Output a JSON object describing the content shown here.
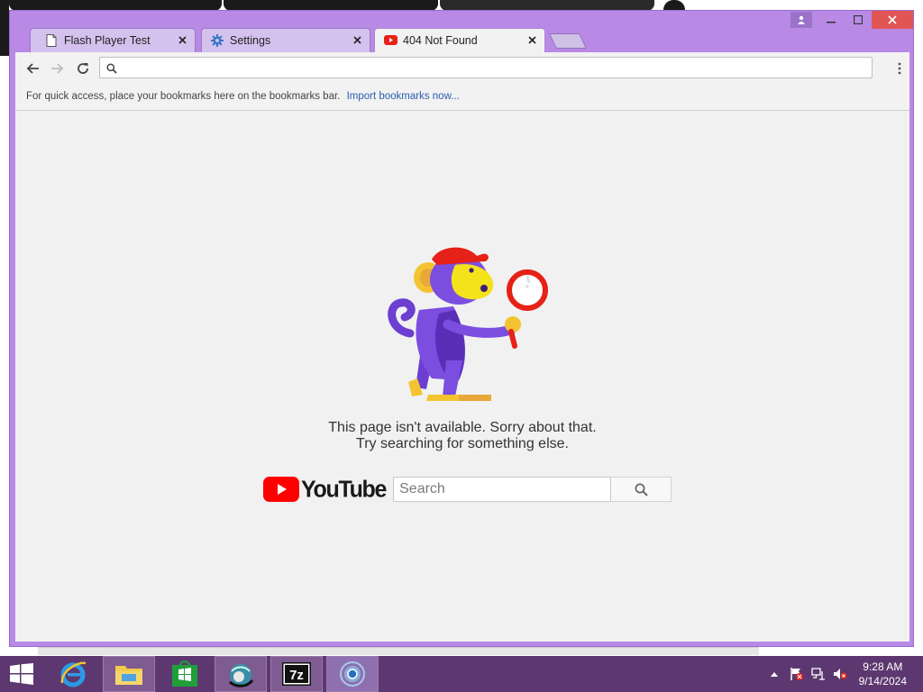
{
  "tabs": [
    {
      "title": "Flash Player Test",
      "icon": "page-icon",
      "active": false
    },
    {
      "title": "Settings",
      "icon": "gear-icon",
      "active": false
    },
    {
      "title": "404 Not Found",
      "icon": "youtube-favicon",
      "active": true
    }
  ],
  "omnibox": {
    "value": "",
    "placeholder": ""
  },
  "bookmarks_bar": {
    "text": "For quick access, place your bookmarks here on the bookmarks bar.",
    "link": "Import bookmarks now..."
  },
  "error_page": {
    "line1": "This page isn't available. Sorry about that.",
    "line2": "Try searching for something else.",
    "brand": "YouTube",
    "search_placeholder": "Search"
  },
  "taskbar": {
    "apps": [
      "start-button",
      "internet-explorer",
      "file-explorer",
      "windows-store",
      "network-app",
      "7zip",
      "chrome"
    ],
    "clock_time": "9:28 AM",
    "clock_date": "9/14/2024"
  },
  "colors": {
    "window_frame": "#b88ae6",
    "taskbar": "#5d3870",
    "youtube_red": "#ff0000"
  }
}
